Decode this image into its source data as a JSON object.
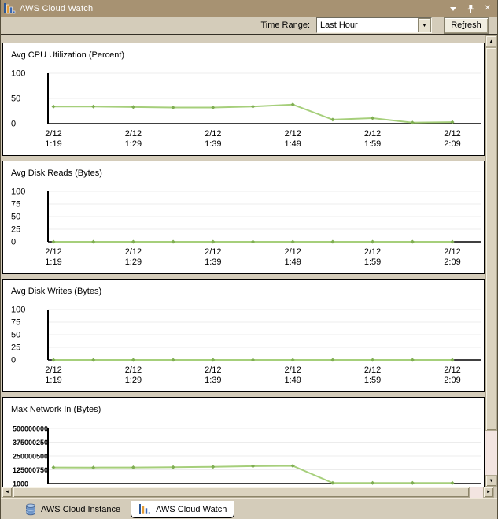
{
  "titlebar": {
    "title": "AWS Cloud Watch"
  },
  "toolbar": {
    "time_range_label": "Time Range:",
    "time_range_value": "Last Hour",
    "refresh": {
      "pre": "Re",
      "mnemonic": "f",
      "post": "resh"
    }
  },
  "icons": {
    "combo_arrow": "▼",
    "close": "✕",
    "scroll_up": "▲",
    "scroll_down": "▼",
    "scroll_left": "◄",
    "scroll_right": "►"
  },
  "colors": {
    "titlebar_bg": "#a79272",
    "panel_bg": "#d4ccba",
    "chart_line": "#a6cf7b",
    "chart_marker": "#7fae52",
    "gridline": "#ececec",
    "axis": "#000000"
  },
  "chart_data": [
    {
      "type": "line",
      "title": "Avg CPU Utilization (Percent)",
      "yticks": [
        100,
        50,
        0
      ],
      "ylim": [
        0,
        100
      ],
      "x_labels": [
        [
          "2/12",
          "1:19"
        ],
        [
          "2/12",
          "1:29"
        ],
        [
          "2/12",
          "1:39"
        ],
        [
          "2/12",
          "1:49"
        ],
        [
          "2/12",
          "1:59"
        ],
        [
          "2/12",
          "2:09"
        ]
      ],
      "values": [
        34,
        34,
        33,
        32,
        32,
        34,
        38,
        8,
        11,
        2,
        3
      ],
      "grid": "horizontal",
      "legend": null
    },
    {
      "type": "line",
      "title": "Avg Disk Reads (Bytes)",
      "yticks": [
        100,
        75,
        50,
        25,
        0
      ],
      "ylim": [
        0,
        100
      ],
      "x_labels": [
        [
          "2/12",
          "1:19"
        ],
        [
          "2/12",
          "1:29"
        ],
        [
          "2/12",
          "1:39"
        ],
        [
          "2/12",
          "1:49"
        ],
        [
          "2/12",
          "1:59"
        ],
        [
          "2/12",
          "2:09"
        ]
      ],
      "values": [
        0,
        0,
        0,
        0,
        0,
        0,
        0,
        0,
        0,
        0,
        0
      ],
      "grid": "horizontal",
      "legend": null
    },
    {
      "type": "line",
      "title": "Avg Disk Writes (Bytes)",
      "yticks": [
        100,
        75,
        50,
        25,
        0
      ],
      "ylim": [
        0,
        100
      ],
      "x_labels": [
        [
          "2/12",
          "1:19"
        ],
        [
          "2/12",
          "1:29"
        ],
        [
          "2/12",
          "1:39"
        ],
        [
          "2/12",
          "1:49"
        ],
        [
          "2/12",
          "1:59"
        ],
        [
          "2/12",
          "2:09"
        ]
      ],
      "values": [
        0,
        0,
        0,
        0,
        0,
        0,
        0,
        0,
        0,
        0,
        0
      ],
      "grid": "horizontal",
      "legend": null
    },
    {
      "type": "line",
      "title": "Max Network In (Bytes)",
      "yticks": [
        500000000,
        375000250,
        250000500,
        125000750,
        1000
      ],
      "ylim": [
        1000,
        500000000
      ],
      "x_labels": [],
      "x_axis_clipped": true,
      "values": [
        146000000,
        145000000,
        146000000,
        148000000,
        152000000,
        158000000,
        161000000,
        5000000,
        5000000,
        5000000,
        5000000
      ],
      "grid": "horizontal",
      "legend": null
    }
  ],
  "tabs": [
    {
      "label": "AWS Cloud Instance",
      "icon": "database-icon",
      "active": false
    },
    {
      "label": "AWS Cloud Watch",
      "icon": "bar-chart-icon",
      "active": true
    }
  ]
}
